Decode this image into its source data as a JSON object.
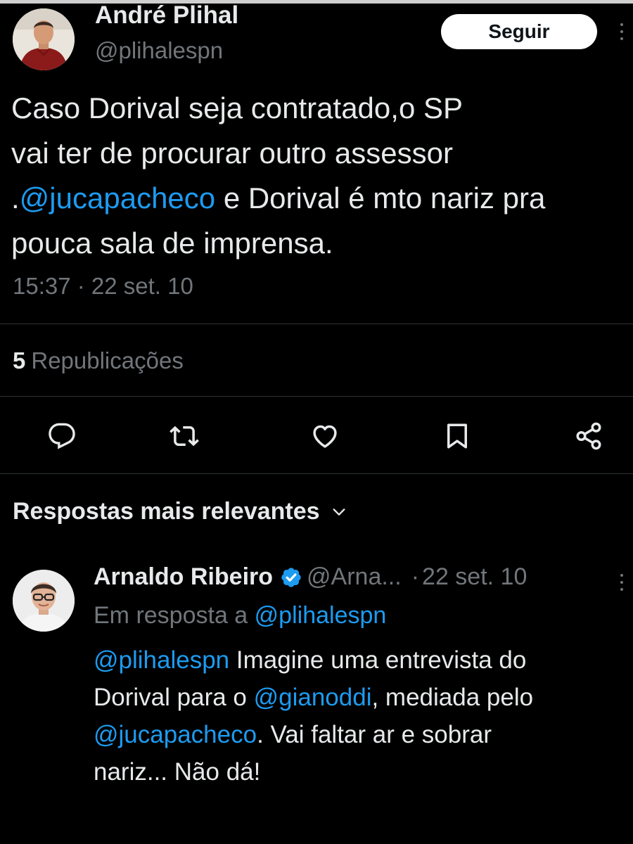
{
  "colors": {
    "background": "#000000",
    "text": "#e7e9ea",
    "secondary_text": "#71767b",
    "link": "#1d9bf0",
    "divider": "#2f3336",
    "follow_button_bg": "#ffffff",
    "verified_badge": "#1d9bf0"
  },
  "tweet": {
    "author": {
      "name": "André Plihal",
      "handle": "@plihalespn",
      "avatar_icon": "profile-photo-icon"
    },
    "follow_label": "Seguir",
    "more_icon": "more-options-icon",
    "text_lines": [
      [
        {
          "t": "Caso Dorival seja contratado,o SP"
        }
      ],
      [
        {
          "t": "vai ter de procurar outro assessor"
        }
      ],
      [
        {
          "t": "."
        },
        {
          "t": "@jucapacheco"
        },
        {
          "t": " e Dorival é mto nariz pra"
        }
      ],
      [
        {
          "t": "pouca sala de imprensa."
        }
      ]
    ],
    "timestamp": "15:37 · 22 set. 10",
    "reposts": {
      "count": "5",
      "label": "Republicações"
    },
    "actions": [
      {
        "name": "reply",
        "icon": "reply-icon"
      },
      {
        "name": "repost",
        "icon": "repost-icon"
      },
      {
        "name": "like",
        "icon": "heart-icon"
      },
      {
        "name": "bookmark",
        "icon": "bookmark-icon"
      },
      {
        "name": "share",
        "icon": "share-icon"
      }
    ]
  },
  "replies_section": {
    "header": "Respostas mais relevantes",
    "header_icon": "chevron-down-icon"
  },
  "reply": {
    "author": {
      "name": "Arnaldo Ribeiro",
      "handle": "@Arna...",
      "verified": true,
      "avatar_icon": "profile-photo-icon"
    },
    "separator": "·",
    "time": "22 set. 10",
    "in_reply_to_prefix": "Em resposta a",
    "in_reply_to_handle": "@plihalespn",
    "text_lines": [
      [
        {
          "t": "@plihalespn"
        },
        {
          "t": " Imagine uma entrevista do"
        }
      ],
      [
        {
          "t": "Dorival para o "
        },
        {
          "t": "@gianoddi"
        },
        {
          "t": ", mediada pelo"
        }
      ],
      [
        {
          "t": "@jucapacheco"
        },
        {
          "t": ". Vai faltar ar e sobrar"
        }
      ],
      [
        {
          "t": "nariz... Não dá!"
        }
      ]
    ]
  }
}
